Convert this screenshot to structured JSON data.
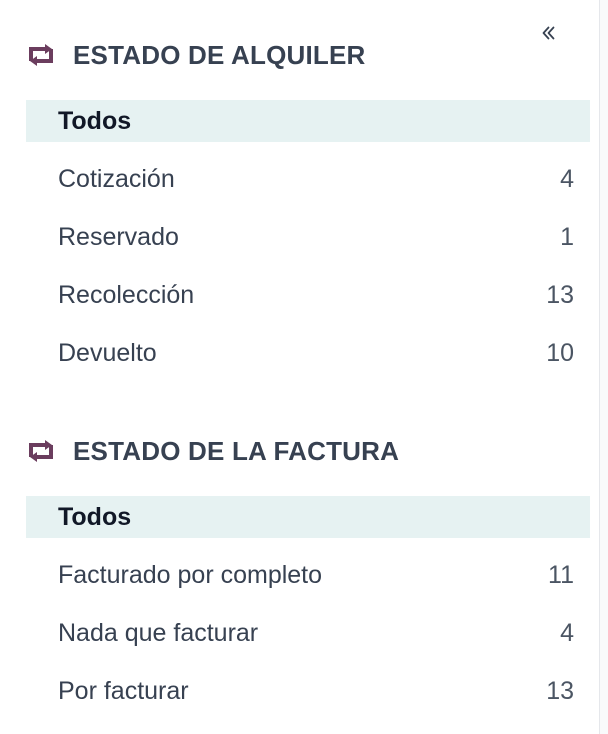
{
  "colors": {
    "icon": "#6b3d5e",
    "active_bg": "#e6f2f2",
    "text": "#374151"
  },
  "collapse": {
    "icon": "chevron-double-left-icon",
    "glyph": "«"
  },
  "sections": [
    {
      "icon": "repeat-arrows-icon",
      "title": "ESTADO DE ALQUILER",
      "items": [
        {
          "label": "Todos",
          "count": null,
          "active": true
        },
        {
          "label": "Cotización",
          "count": "4"
        },
        {
          "label": "Reservado",
          "count": "1"
        },
        {
          "label": "Recolección",
          "count": "13"
        },
        {
          "label": "Devuelto",
          "count": "10"
        }
      ]
    },
    {
      "icon": "repeat-arrows-icon",
      "title": "ESTADO DE LA FACTURA",
      "items": [
        {
          "label": "Todos",
          "count": null,
          "active": true
        },
        {
          "label": "Facturado por completo",
          "count": "11"
        },
        {
          "label": "Nada que facturar",
          "count": "4"
        },
        {
          "label": "Por facturar",
          "count": "13"
        }
      ]
    }
  ]
}
